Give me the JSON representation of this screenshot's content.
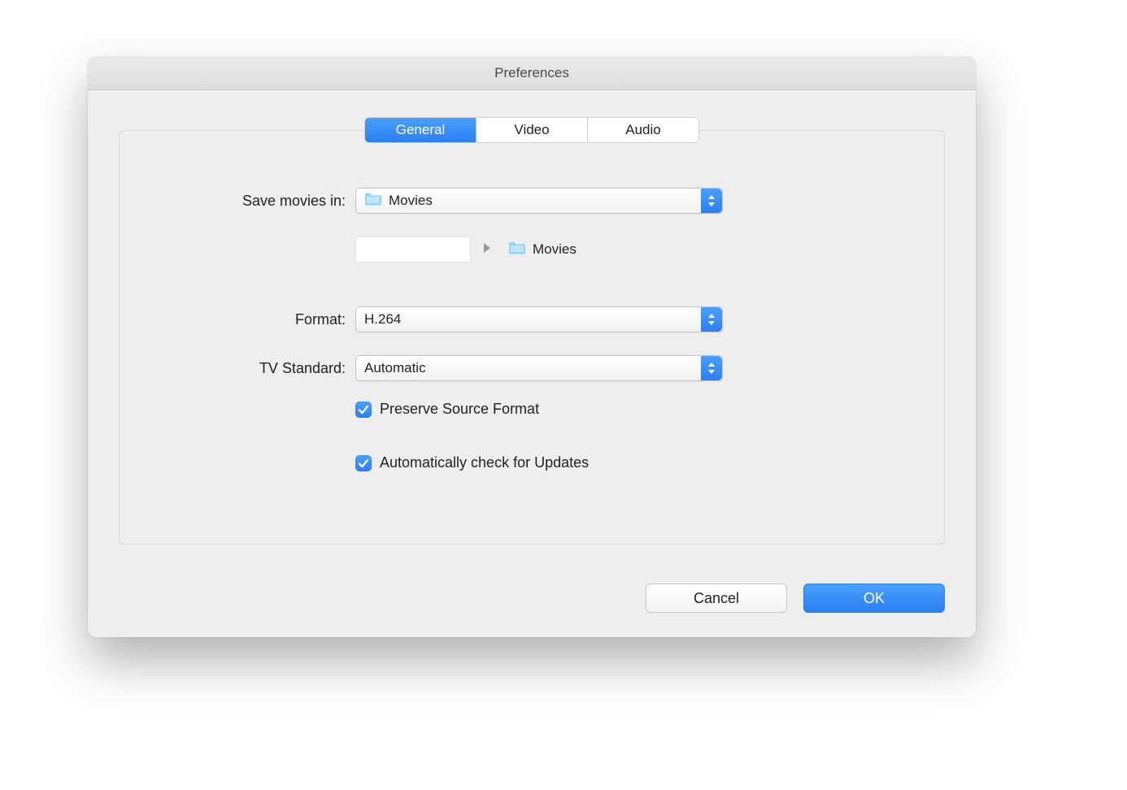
{
  "window": {
    "title": "Preferences"
  },
  "tabs": {
    "general": "General",
    "video": "Video",
    "audio": "Audio",
    "active": "general"
  },
  "form": {
    "save_location": {
      "label": "Save movies in:",
      "value": "Movies",
      "path": {
        "current": "Movies"
      }
    },
    "format": {
      "label": "Format:",
      "value": "H.264"
    },
    "tv_standard": {
      "label": "TV Standard:",
      "value": "Automatic"
    },
    "preserve_source": {
      "label": "Preserve Source Format",
      "checked": true
    },
    "auto_update": {
      "label": "Automatically check for Updates",
      "checked": true
    }
  },
  "footer": {
    "cancel": "Cancel",
    "ok": "OK"
  }
}
